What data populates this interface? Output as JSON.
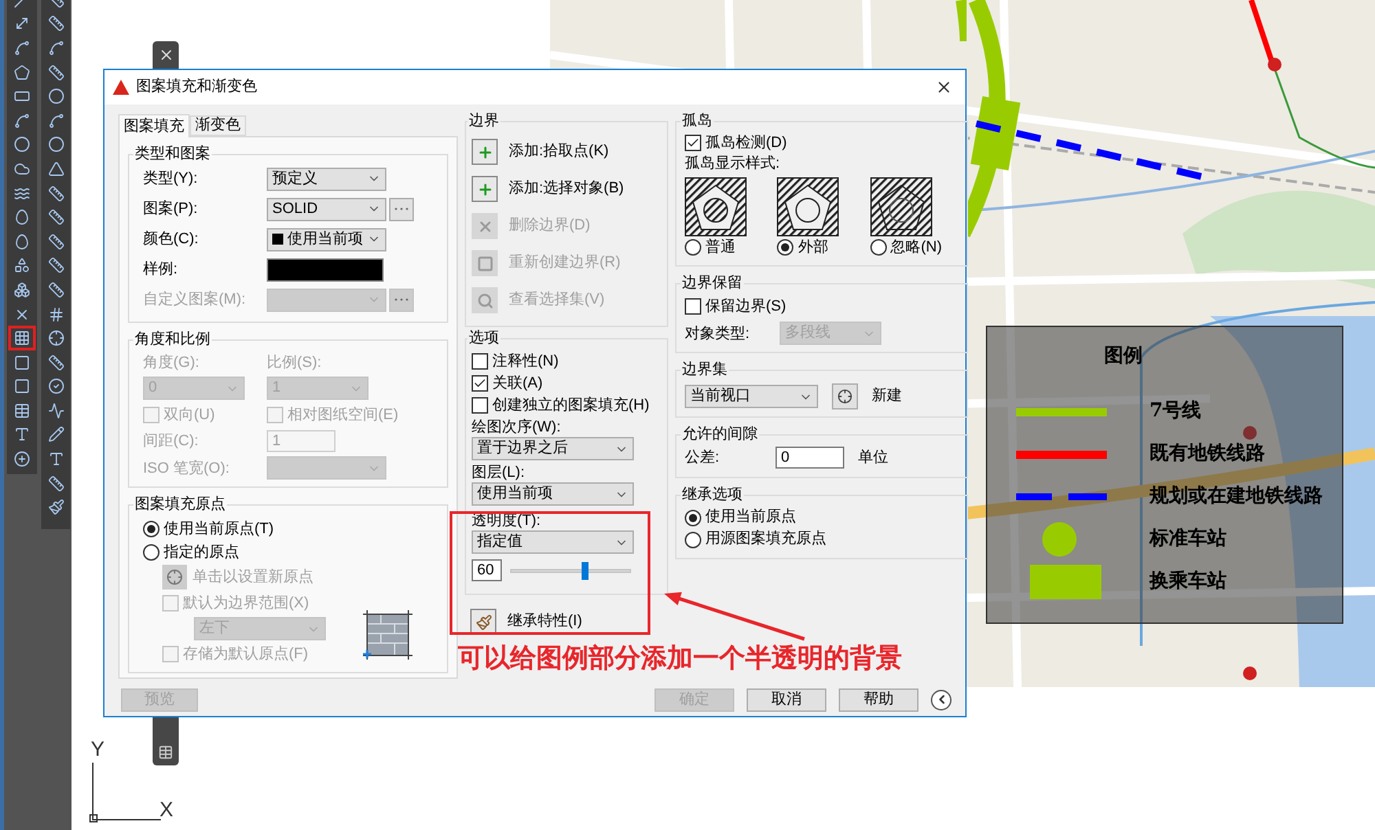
{
  "cad": {
    "left_tools": [
      {
        "kind": "line",
        "highlighted": false
      },
      {
        "kind": "construction",
        "highlighted": false
      },
      {
        "kind": "polyline",
        "highlighted": false
      },
      {
        "kind": "polygon",
        "highlighted": false
      },
      {
        "kind": "rectangle",
        "highlighted": false
      },
      {
        "kind": "arc",
        "highlighted": false
      },
      {
        "kind": "circle",
        "highlighted": false
      },
      {
        "kind": "cloud",
        "highlighted": false
      },
      {
        "kind": "spline",
        "highlighted": false
      },
      {
        "kind": "ellipse",
        "highlighted": false
      },
      {
        "kind": "ellipse",
        "highlighted": false
      },
      {
        "kind": "insert",
        "highlighted": false
      },
      {
        "kind": "block",
        "highlighted": false
      },
      {
        "kind": "point",
        "highlighted": false
      },
      {
        "kind": "hatch",
        "highlighted": true
      },
      {
        "kind": "gradient",
        "highlighted": false
      },
      {
        "kind": "region",
        "highlighted": false
      },
      {
        "kind": "table",
        "highlighted": false
      },
      {
        "kind": "text",
        "highlighted": false
      },
      {
        "kind": "add",
        "highlighted": false
      }
    ],
    "right_tools": [
      {
        "kind": "dimension"
      },
      {
        "kind": "dimension"
      },
      {
        "kind": "arc"
      },
      {
        "kind": "dimension"
      },
      {
        "kind": "circle"
      },
      {
        "kind": "arc"
      },
      {
        "kind": "circle"
      },
      {
        "kind": "angle"
      },
      {
        "kind": "dimension"
      },
      {
        "kind": "dimension"
      },
      {
        "kind": "dimension"
      },
      {
        "kind": "dimension"
      },
      {
        "kind": "dimension"
      },
      {
        "kind": "tolerance"
      },
      {
        "kind": "marker"
      },
      {
        "kind": "dimension"
      },
      {
        "kind": "inspect"
      },
      {
        "kind": "jog"
      },
      {
        "kind": "edit"
      },
      {
        "kind": "text"
      },
      {
        "kind": "dimension"
      },
      {
        "kind": "brush"
      }
    ],
    "axes": {
      "y": "Y",
      "x": "X"
    }
  },
  "map_legend": {
    "title": "图例",
    "items": [
      {
        "kind": "line",
        "color": "#99cc00",
        "label": "7号线"
      },
      {
        "kind": "line",
        "color": "#ff0000",
        "label": "既有地铁线路"
      },
      {
        "kind": "dashed",
        "color": "#0000ff",
        "label": "规划或在建地铁线路"
      },
      {
        "kind": "circle",
        "color": "#99cc00",
        "label": "标准车站"
      },
      {
        "kind": "rect",
        "color": "#99cc00",
        "label": "换乘车站"
      }
    ]
  },
  "dialog": {
    "title": "图案填充和渐变色",
    "tabs": [
      {
        "label": "图案填充",
        "selected": true
      },
      {
        "label": "渐变色",
        "selected": false
      }
    ],
    "type_pattern": {
      "title": "类型和图案",
      "fields": [
        {
          "kind": "dropdown",
          "label": "类型(Y):",
          "value": "预定义",
          "disabled": false
        },
        {
          "kind": "dropdown_browse",
          "label": "图案(P):",
          "value": "SOLID",
          "disabled": false
        },
        {
          "kind": "color",
          "label": "颜色(C):",
          "value": "使用当前项",
          "disabled": false
        },
        {
          "kind": "swatch",
          "label": "样例:",
          "disabled": false
        },
        {
          "kind": "dropdown_browse",
          "label": "自定义图案(M):",
          "disabled": true
        }
      ]
    },
    "angle_scale": {
      "title": "角度和比例",
      "angle": {
        "label": "角度(G):",
        "value": "0",
        "disabled": true
      },
      "scale": {
        "label": "比例(S):",
        "value": "1",
        "disabled": true
      },
      "double": {
        "label": "双向(U)",
        "checked": false,
        "disabled": true
      },
      "relative": {
        "label": "相对图纸空间(E)",
        "checked": false,
        "disabled": true
      },
      "spacing": {
        "label": "间距(C):",
        "value": "1",
        "disabled": true
      },
      "iso": {
        "label": "ISO 笔宽(O):",
        "disabled": true
      }
    },
    "origin": {
      "title": "图案填充原点",
      "options": [
        {
          "label": "使用当前原点(T)",
          "selected": true
        },
        {
          "label": "指定的原点",
          "selected": false
        }
      ],
      "set_button": {
        "label": "单击以设置新原点",
        "disabled": true
      },
      "default_extents": {
        "label": "默认为边界范围(X)",
        "checked": false,
        "disabled": true
      },
      "position": {
        "value": "左下",
        "disabled": true
      },
      "store_default": {
        "label": "存储为默认原点(F)",
        "checked": false,
        "disabled": true
      }
    },
    "preview_button": {
      "label": "预览",
      "disabled": true
    },
    "boundaries": {
      "title": "边界",
      "actions": [
        {
          "kind": "pick",
          "label": "添加:拾取点(K)",
          "disabled": false
        },
        {
          "kind": "select",
          "label": "添加:选择对象(B)",
          "disabled": false
        },
        {
          "kind": "remove",
          "label": "删除边界(D)",
          "disabled": true
        },
        {
          "kind": "recreate",
          "label": "重新创建边界(R)",
          "disabled": true
        },
        {
          "kind": "view",
          "label": "查看选择集(V)",
          "disabled": true
        }
      ]
    },
    "options": {
      "title": "选项",
      "checks": [
        {
          "label": "注释性(N)",
          "checked": false
        },
        {
          "label": "关联(A)",
          "checked": true
        },
        {
          "label": "创建独立的图案填充(H)",
          "checked": false
        }
      ],
      "draw_order": {
        "label": "绘图次序(W):",
        "value": "置于边界之后"
      },
      "layer": {
        "label": "图层(L):",
        "value": "使用当前项"
      },
      "transparency": {
        "label": "透明度(T):",
        "value": "指定值",
        "amount": "60",
        "level": 0.62
      }
    },
    "inherit_button": {
      "label": "继承特性(I)"
    },
    "islands": {
      "title": "孤岛",
      "detect": {
        "label": "孤岛检测(D)",
        "checked": true
      },
      "style_label": "孤岛显示样式:",
      "styles": [
        {
          "kind": "normal",
          "label": "普通",
          "selected": false
        },
        {
          "kind": "outer",
          "label": "外部",
          "selected": true
        },
        {
          "kind": "ignore",
          "label": "忽略(N)",
          "selected": false
        }
      ]
    },
    "retain": {
      "title": "边界保留",
      "retain": {
        "label": "保留边界(S)",
        "checked": false
      },
      "object_type": {
        "label": "对象类型:",
        "value": "多段线",
        "disabled": true
      }
    },
    "boundary_set": {
      "title": "边界集",
      "value": "当前视口",
      "new_label": "新建"
    },
    "gap": {
      "title": "允许的间隙",
      "label": "公差:",
      "value": "0",
      "unit": "单位"
    },
    "inherit_options": {
      "title": "继承选项",
      "options": [
        {
          "label": "使用当前原点",
          "selected": true
        },
        {
          "label": "用源图案填充原点",
          "selected": false
        }
      ]
    },
    "buttons": [
      {
        "label": "确定",
        "disabled": true
      },
      {
        "label": "取消",
        "disabled": false
      },
      {
        "label": "帮助",
        "disabled": false
      }
    ]
  },
  "annotation": {
    "text": "可以给图例部分添加一个半透明的背景"
  }
}
